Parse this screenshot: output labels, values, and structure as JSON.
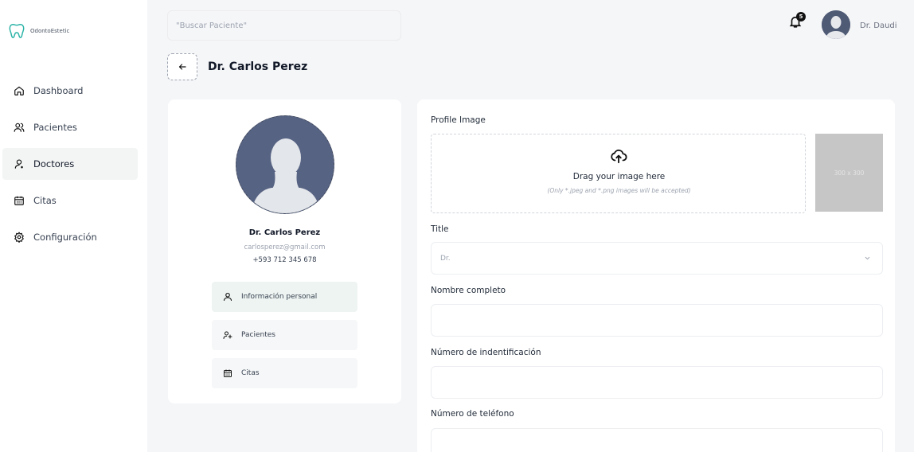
{
  "app": {
    "name": "OdontoEstetic"
  },
  "sidebar": {
    "items": [
      {
        "label": "Dashboard",
        "icon": "home-icon",
        "active": false
      },
      {
        "label": "Pacientes",
        "icon": "users-icon",
        "active": false
      },
      {
        "label": "Doctores",
        "icon": "user-icon",
        "active": true
      },
      {
        "label": "Citas",
        "icon": "calendar-icon",
        "active": false
      },
      {
        "label": "Configuración",
        "icon": "gear-icon",
        "active": false
      }
    ]
  },
  "header": {
    "search_placeholder": "\"Buscar Paciente\"",
    "notification_count": "5",
    "user_name": "Dr. Daudi"
  },
  "page": {
    "title": "Dr. Carlos Perez"
  },
  "profile": {
    "name": "Dr. Carlos Perez",
    "email": "carlosperez@gmail.com",
    "phone": "+593 712 345 678",
    "menu": [
      {
        "label": "Información personal",
        "icon": "user-icon",
        "active": true
      },
      {
        "label": "Pacientes",
        "icon": "user-plus-icon",
        "active": false
      },
      {
        "label": "Citas",
        "icon": "calendar-icon",
        "active": false
      }
    ]
  },
  "form": {
    "profile_image_label": "Profile Image",
    "upload_text": "Drag your image here",
    "upload_hint": "(Only *.jpeg and *.png images will be accepted)",
    "placeholder_image_text": "300 x 300",
    "title_label": "Title",
    "title_value": "Dr.",
    "fullname_label": "Nombre completo",
    "id_label": "Número de indentificación",
    "phone_label": "Número de teléfono"
  },
  "colors": {
    "accent": "#2ab3a6",
    "active_bg": "#f3f5f5",
    "avatar_bg": "#576383"
  }
}
